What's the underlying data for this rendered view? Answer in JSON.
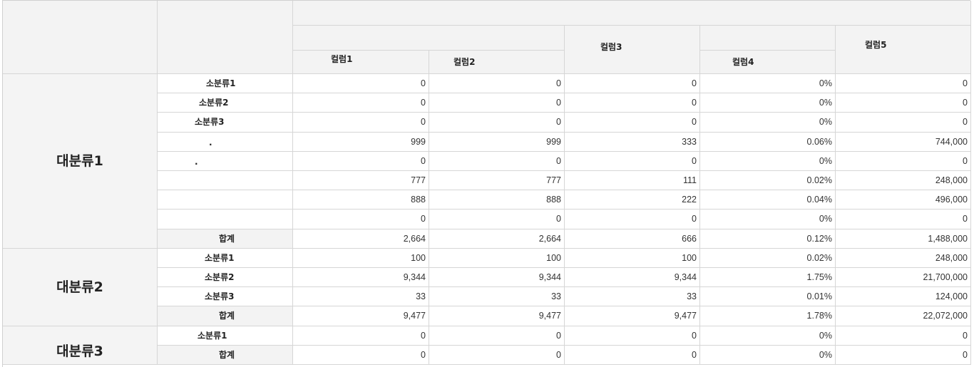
{
  "table": {
    "headers": {
      "col1": "컬럼1",
      "col2": "컬럼2",
      "col3": "컬럼3",
      "col4": "컬럼4",
      "col5": "컬럼5"
    },
    "groups": [
      {
        "label": "대분류1",
        "rows": [
          {
            "sub": "소분류1",
            "values": [
              "0",
              "0",
              "0",
              "0%",
              "0"
            ]
          },
          {
            "sub": "소분류2",
            "values": [
              "0",
              "0",
              "0",
              "0%",
              "0"
            ]
          },
          {
            "sub": "소분류3",
            "values": [
              "0",
              "0",
              "0",
              "0%",
              "0"
            ]
          },
          {
            "sub": ".",
            "values": [
              "999",
              "999",
              "333",
              "0.06%",
              "744,000"
            ]
          },
          {
            "sub": ".",
            "values": [
              "0",
              "0",
              "0",
              "0%",
              "0"
            ]
          },
          {
            "sub": "",
            "values": [
              "777",
              "777",
              "111",
              "0.02%",
              "248,000"
            ]
          },
          {
            "sub": "",
            "values": [
              "888",
              "888",
              "222",
              "0.04%",
              "496,000"
            ]
          },
          {
            "sub": "",
            "values": [
              "0",
              "0",
              "0",
              "0%",
              "0"
            ]
          },
          {
            "sub": "합계",
            "total": true,
            "values": [
              "2,664",
              "2,664",
              "666",
              "0.12%",
              "1,488,000"
            ]
          }
        ]
      },
      {
        "label": "대분류2",
        "rows": [
          {
            "sub": "소분류1",
            "values": [
              "100",
              "100",
              "100",
              "0.02%",
              "248,000"
            ]
          },
          {
            "sub": "소분류2",
            "values": [
              "9,344",
              "9,344",
              "9,344",
              "1.75%",
              "21,700,000"
            ]
          },
          {
            "sub": "소분류3",
            "values": [
              "33",
              "33",
              "33",
              "0.01%",
              "124,000"
            ]
          },
          {
            "sub": "합계",
            "total": true,
            "values": [
              "9,477",
              "9,477",
              "9,477",
              "1.78%",
              "22,072,000"
            ]
          }
        ]
      },
      {
        "label": "대분류3",
        "rows": [
          {
            "sub": "소분류1",
            "values": [
              "0",
              "0",
              "0",
              "0%",
              "0"
            ]
          },
          {
            "sub": "합계",
            "total": true,
            "values": [
              "0",
              "0",
              "0",
              "0%",
              "0"
            ]
          }
        ]
      }
    ]
  }
}
